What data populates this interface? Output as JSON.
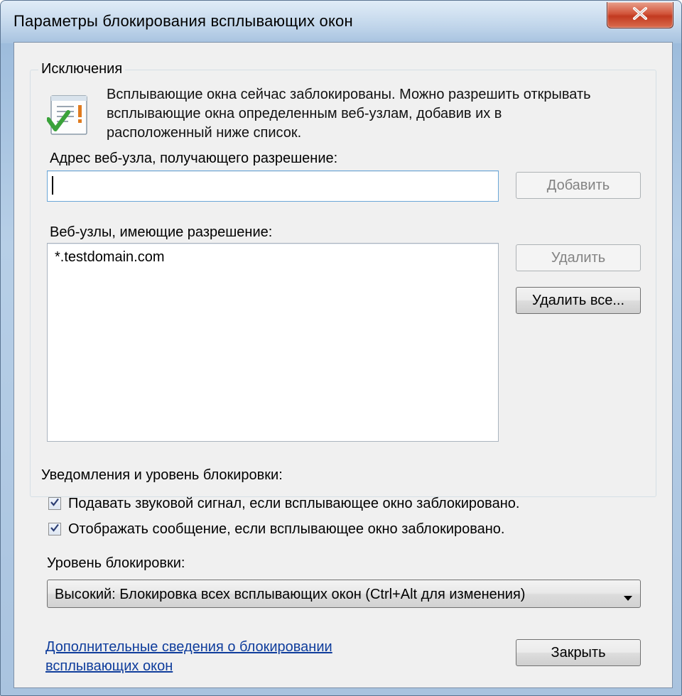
{
  "window": {
    "title": "Параметры блокирования всплывающих окон",
    "close_glyph": "✕"
  },
  "exceptions": {
    "legend": "Исключения",
    "info_text": "Всплывающие окна сейчас заблокированы. Можно разрешить открывать всплывающие окна определенным веб-узлам, добавив их в расположенный ниже список.",
    "address_label": "Адрес веб-узла, получающего разрешение:",
    "address_value": "",
    "add_button": "Добавить",
    "allowed_label": "Веб-узлы, имеющие разрешение:",
    "allowed_sites": [
      "*.testdomain.com"
    ],
    "remove_button": "Удалить",
    "remove_all_button": "Удалить все..."
  },
  "notifications": {
    "heading": "Уведомления и уровень блокировки:",
    "sound_checkbox": {
      "label": "Подавать звуковой сигнал, если всплывающее окно заблокировано.",
      "checked": true
    },
    "message_checkbox": {
      "label": "Отображать сообщение, если всплывающее окно заблокировано.",
      "checked": true
    },
    "level_label": "Уровень блокировки:",
    "level_value": "Высокий: Блокировка всех всплывающих окон (Ctrl+Alt для изменения)"
  },
  "footer": {
    "help_link": "Дополнительные сведения о блокировании всплывающих окон",
    "close_button": "Закрыть"
  },
  "colors": {
    "link": "#0f3d9c",
    "dialog_bg": "#f0f0f0",
    "frame": "#a9c3df",
    "close_red": "#c23a20"
  }
}
